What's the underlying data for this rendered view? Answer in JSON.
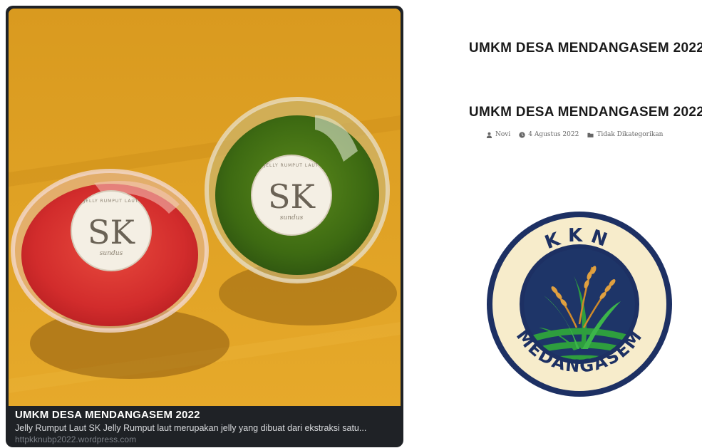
{
  "preview_card": {
    "title": "UMKM DESA MENDANGASEM 2022",
    "description": "Jelly Rumput Laut SK Jelly Rumput laut merupakan jelly yang dibuat dari ekstraksi satu...",
    "url": "httpkknubp2022.wordpress.com",
    "photo": {
      "lid_mark": "SK",
      "lid_ring_text": "JELLY RUMPUT LAUT",
      "lid_sub_text": "sundus"
    }
  },
  "blog": {
    "site_title": "UMKM DESA MENDANGASEM 2022",
    "post_title": "UMKM DESA MENDANGASEM 2022",
    "meta": {
      "author": "Novi",
      "date": "4 Agustus 2022",
      "category": "Tidak Dikategorikan"
    },
    "logo": {
      "top_text": "KKN",
      "bottom_text": "MEDANGASEM",
      "colors": {
        "navy": "#1d3063",
        "green": "#2e9e3e",
        "cream": "#f7eccb",
        "gold": "#d08a2a"
      }
    }
  }
}
